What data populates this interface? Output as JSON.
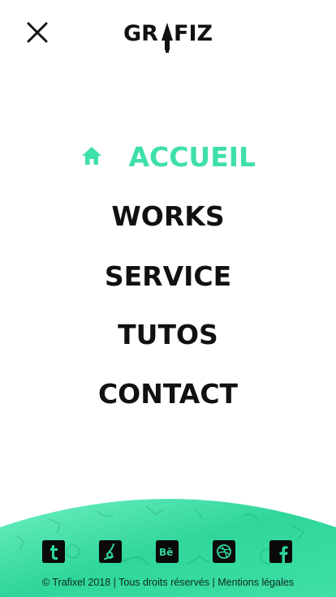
{
  "header": {
    "close_icon": "close-icon",
    "logo_text": "GR FIZ",
    "logo_letters_left": "GR",
    "logo_letters_right": "FIZ"
  },
  "nav": {
    "items": [
      {
        "label": "ACCUEIL",
        "active": true,
        "icon": "home-icon"
      },
      {
        "label": "WORKS",
        "active": false
      },
      {
        "label": "SERVICE",
        "active": false
      },
      {
        "label": "TUTOS",
        "active": false
      },
      {
        "label": "CONTACT",
        "active": false
      }
    ]
  },
  "footer": {
    "social": [
      {
        "name": "tumblr-icon",
        "glyph": "t"
      },
      {
        "name": "deviantart-icon",
        "glyph": "ꝺ"
      },
      {
        "name": "behance-icon",
        "glyph": "Bē"
      },
      {
        "name": "dribbble-icon",
        "glyph": "◎"
      },
      {
        "name": "facebook-icon",
        "glyph": "f"
      }
    ],
    "copyright": "© Trafixel 2018",
    "rights": "Tous droits réservés",
    "legal": "Mentions légales",
    "separator": "|"
  },
  "colors": {
    "accent": "#3ee0a8",
    "text": "#111111",
    "footer_green": "#2fd69a",
    "footer_green_light": "#6ff0c2"
  }
}
